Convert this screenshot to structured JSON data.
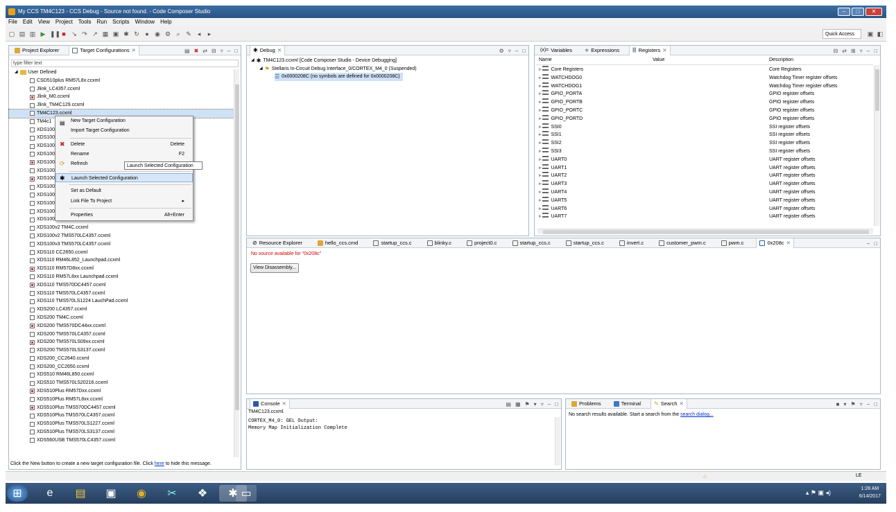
{
  "window": {
    "title": "My CCS TM4C123 - CCS Debug - Source not found. - Code Composer Studio"
  },
  "menubar": [
    "File",
    "Edit",
    "View",
    "Project",
    "Tools",
    "Run",
    "Scripts",
    "Window",
    "Help"
  ],
  "toolbar": {
    "quick_access": "Quick Access"
  },
  "left": {
    "tabs": [
      "Project Explorer",
      "Target Configurations"
    ],
    "filter_placeholder": "type filter text",
    "root": "User Defined",
    "items": [
      {
        "label": "CSD510plus RM57L8x.ccxml",
        "red": false
      },
      {
        "label": "Jlink_LC4357.ccxml",
        "red": false
      },
      {
        "label": "Jlink_M0.ccxml",
        "red": true
      },
      {
        "label": "Jlink_TM4C129.ccxml",
        "red": false
      },
      {
        "label": "TM4C123.ccxml",
        "red": false
      },
      {
        "label": "TM4c1",
        "red": false
      },
      {
        "label": "XDS100",
        "red": false
      },
      {
        "label": "XDS100",
        "red": false
      },
      {
        "label": "XDS100",
        "red": false
      },
      {
        "label": "XDS100",
        "red": false
      },
      {
        "label": "XDS100",
        "red": true
      },
      {
        "label": "XDS100",
        "red": false
      },
      {
        "label": "XDS100",
        "red": true
      },
      {
        "label": "XDS100",
        "red": false
      },
      {
        "label": "XDS100",
        "red": false
      },
      {
        "label": "XDS100",
        "red": false
      },
      {
        "label": "XDS100 TMS570LS3137.ccxml",
        "red": false
      },
      {
        "label": "XDS100v2 RM57L8.ccxml",
        "red": false
      },
      {
        "label": "XDS100v2 TM4C.ccxml",
        "red": false
      },
      {
        "label": "XDS100v2 TMS570LC4357.ccxml",
        "red": false
      },
      {
        "label": "XDS100v3 TMS570LC4357.ccxml",
        "red": false
      },
      {
        "label": "XDS110 CC2650.ccxml",
        "red": false
      },
      {
        "label": "XDS110 RM46L852_Launchpad.ccxml",
        "red": false
      },
      {
        "label": "XDS110 RM57D8xx.ccxml",
        "red": true
      },
      {
        "label": "XDS110 RM57L8xx Launchpad.ccxml",
        "red": false
      },
      {
        "label": "XDS110 TMS570DC4457.ccxml",
        "red": true
      },
      {
        "label": "XDS110 TMS570LC4357.ccxml",
        "red": false
      },
      {
        "label": "XDS110 TMS570LS1224 LauchPad.ccxml",
        "red": false
      },
      {
        "label": "XDS200 LC4357.ccxml",
        "red": false
      },
      {
        "label": "XDS200 TM4C.ccxml",
        "red": false
      },
      {
        "label": "XDS200 TMS570DC44xx.ccxml",
        "red": true
      },
      {
        "label": "XDS200 TMS570LC4357.ccxml",
        "red": false
      },
      {
        "label": "XDS200 TMS570LS09xx.ccxml",
        "red": true
      },
      {
        "label": "XDS200 TMS570LS3137.ccxml",
        "red": false
      },
      {
        "label": "XDS200_CC2640.ccxml",
        "red": false
      },
      {
        "label": "XDS200_CC2650.ccxml",
        "red": false
      },
      {
        "label": "XDS510 RM46L850.ccxml",
        "red": false
      },
      {
        "label": "XDS510 TMS570LS20216.ccxml",
        "red": false
      },
      {
        "label": "XDS510Plus RM57Dxx.ccxml",
        "red": true
      },
      {
        "label": "XDS510Plus RM57L8xx.ccxml",
        "red": false
      },
      {
        "label": "XDS510Plus TMS570DC4457.ccxml",
        "red": true
      },
      {
        "label": "XDS510Plus TMS570LC4357.ccxml",
        "red": false
      },
      {
        "label": "XDS510Plus TMS570LS1227.ccxml",
        "red": false
      },
      {
        "label": "XDS510Plus TMS570LS3137.ccxml",
        "red": false
      },
      {
        "label": "XDS560USB TMS570LC4357.ccxml",
        "red": false
      }
    ],
    "status_prefix": "Click the New button to create a new target configuration file. Click ",
    "status_link": "here",
    "status_suffix": " to hide this message."
  },
  "context_menu": {
    "items": [
      {
        "label": "New Target Configuration",
        "shortcut": ""
      },
      {
        "label": "Import Target Configuration",
        "shortcut": ""
      },
      {
        "label": "Delete",
        "shortcut": "Delete"
      },
      {
        "label": "Rename",
        "shortcut": "F2"
      },
      {
        "label": "Refresh",
        "shortcut": ""
      },
      {
        "label": "Launch Selected Configuration",
        "shortcut": ""
      },
      {
        "label": "Set as Default",
        "shortcut": ""
      },
      {
        "label": "Link File To Project",
        "shortcut": "▸"
      },
      {
        "label": "Properties",
        "shortcut": "Alt+Enter"
      }
    ],
    "tooltip": "Launch Selected Configuration"
  },
  "debug": {
    "tab": "Debug",
    "line1": "TM4C123.ccxml [Code Composer Studio - Device Debugging]",
    "line2": "Stellaris In-Circuit Debug Interface_0/CORTEX_M4_0 (Suspended)",
    "line3": "0x0000208C  (no symbols are defined for 0x0000208C)"
  },
  "vars": {
    "tabs": [
      "Variables",
      "Expressions",
      "Registers"
    ],
    "headers": [
      "Name",
      "Value",
      "Description"
    ],
    "rows": [
      {
        "name": "Core Registers",
        "desc": "Core Registers"
      },
      {
        "name": "WATCHDOG0",
        "desc": "Watchdog Timer register offsets"
      },
      {
        "name": "WATCHDOG1",
        "desc": "Watchdog Timer register offsets"
      },
      {
        "name": "GPIO_PORTA",
        "desc": "GPIO register offsets"
      },
      {
        "name": "GPIO_PORTB",
        "desc": "GPIO register offsets"
      },
      {
        "name": "GPIO_PORTC",
        "desc": "GPIO register offsets"
      },
      {
        "name": "GPIO_PORTD",
        "desc": "GPIO register offsets"
      },
      {
        "name": "SSI0",
        "desc": "SSI register offsets"
      },
      {
        "name": "SSI1",
        "desc": "SSI register offsets"
      },
      {
        "name": "SSI2",
        "desc": "SSI register offsets"
      },
      {
        "name": "SSI3",
        "desc": "SSI register offsets"
      },
      {
        "name": "UART0",
        "desc": "UART register offsets"
      },
      {
        "name": "UART1",
        "desc": "UART register offsets"
      },
      {
        "name": "UART2",
        "desc": "UART register offsets"
      },
      {
        "name": "UART3",
        "desc": "UART register offsets"
      },
      {
        "name": "UART4",
        "desc": "UART register offsets"
      },
      {
        "name": "UART5",
        "desc": "UART register offsets"
      },
      {
        "name": "UART6",
        "desc": "UART register offsets"
      },
      {
        "name": "UART7",
        "desc": "UART register offsets"
      }
    ]
  },
  "editor": {
    "tabs": [
      "Resource Explorer",
      "hello_ccs.cmd",
      "startup_ccs.c",
      "blinky.c",
      "project0.c",
      "startup_ccs.c",
      "startup_ccs.c",
      "invert.c",
      "customer_pwm.c",
      "pwm.c",
      "0x208c"
    ],
    "message": "No source available for \"0x208c\"",
    "button": "View Disassembly..."
  },
  "console": {
    "tab": "Console",
    "title": "TM4C123.ccxml",
    "lines": [
      "CORTEX_M4_0: GEL Output:",
      "Memory Map Initialization Complete"
    ]
  },
  "search": {
    "tabs": [
      "Problems",
      "Terminal",
      "Search"
    ],
    "msg_prefix": "No search results available. Start a search from the ",
    "msg_link": "search dialog..."
  },
  "statusbar": {
    "mode": "LE"
  },
  "taskbar": {
    "time": "1:28 AM",
    "date": "6/14/2017"
  }
}
